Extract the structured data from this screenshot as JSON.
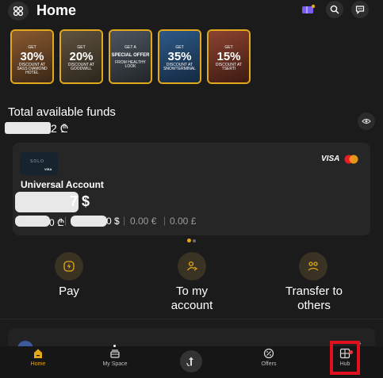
{
  "header": {
    "title": "Home",
    "icons": {
      "logo": "clover-icon",
      "promo": "ticket-icon",
      "search": "search-icon",
      "chat": "chat-icon"
    }
  },
  "offers": [
    {
      "get": "GET",
      "amount": "30%",
      "subtitle": "DISCOUNT AT SASS DIAMOND HOTEL",
      "bg": "#6b4a2c"
    },
    {
      "get": "GET",
      "amount": "20%",
      "subtitle": "DISCOUNT AT GOODWILL",
      "bg": "#4a4032"
    },
    {
      "get": "GET A",
      "amount": "SPECIAL OFFER",
      "subtitle": "FROM HEALTHY LOOK",
      "bg": "#3b4047"
    },
    {
      "get": "GET",
      "amount": "35%",
      "subtitle": "DISCOUNT AT SNOWTERMINAL",
      "bg": "#1f3a5a"
    },
    {
      "get": "GET",
      "amount": "15%",
      "subtitle": "DISCOUNT AT TSERTI",
      "bg": "#6a3124"
    }
  ],
  "funds": {
    "title": "Total available funds",
    "value_visible": "2 ₾"
  },
  "account": {
    "card_brand": "VISA",
    "card_name": "SOLO",
    "card_visa": "VISA",
    "name": "Universal Account",
    "balance_visible": "7 $",
    "balances": [
      {
        "visible": "0 ₾"
      },
      {
        "visible": "0 $"
      },
      {
        "visible": "0.00 €"
      },
      {
        "visible": "0.00 £"
      }
    ],
    "separator": "|"
  },
  "actions": [
    {
      "label": "Pay",
      "icon": "bolt-icon"
    },
    {
      "label": "To my account",
      "icon": "transfer-self-icon"
    },
    {
      "label": "Transfer to others",
      "icon": "people-icon"
    }
  ],
  "peek": {
    "chevron": "›"
  },
  "nav": [
    {
      "label": "Home",
      "icon": "home-icon"
    },
    {
      "label": "My Space",
      "icon": "stack-icon"
    },
    {
      "label": "",
      "icon": "payment-icon"
    },
    {
      "label": "Offers",
      "icon": "offers-icon"
    },
    {
      "label": "Hub",
      "icon": "hub-icon"
    }
  ],
  "colors": {
    "accent": "#e2a91c",
    "background": "#1b1b1b",
    "card": "#262626",
    "highlight": "#e0101c"
  }
}
